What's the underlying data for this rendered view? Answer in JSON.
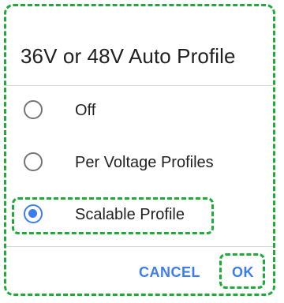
{
  "dialog": {
    "title": "36V or 48V Auto Profile",
    "options": [
      {
        "label": "Off",
        "selected": false
      },
      {
        "label": "Per Voltage Profiles",
        "selected": false
      },
      {
        "label": "Scalable Profile",
        "selected": true
      }
    ],
    "buttons": {
      "cancel_label": "CANCEL",
      "ok_label": "OK"
    }
  },
  "colors": {
    "accent": "#3d7cf0",
    "highlight_outline": "#1faa3a",
    "unselected_radio": "#757575"
  }
}
